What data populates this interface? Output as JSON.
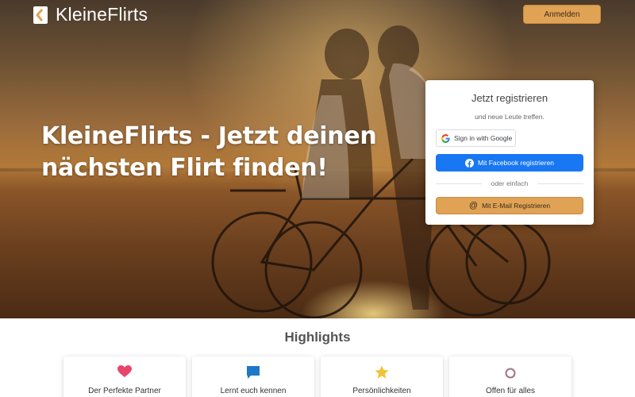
{
  "brand": {
    "name": "KleineFlirts",
    "colors": {
      "accent": "#e0a356",
      "facebook": "#1877f2",
      "heart": "#e8456b",
      "chat": "#1e78c8",
      "star": "#f1c232"
    }
  },
  "header": {
    "login_label": "Anmelden"
  },
  "hero": {
    "title": "KleineFlirts - Jetzt deinen nächsten Flirt finden!"
  },
  "registration": {
    "title": "Jetzt registrieren",
    "subtitle": "und neue Leute treffen.",
    "google_label": "Sign in with Google",
    "facebook_label": "Mit Facebook registrieren",
    "divider": "oder einfach",
    "email_label": "Mit E-Mail Registrieren"
  },
  "highlights": {
    "title": "Highlights",
    "items": [
      {
        "icon": "heart-icon",
        "label": "Der Perfekte Partner"
      },
      {
        "icon": "chat-icon",
        "label": "Lernt euch kennen"
      },
      {
        "icon": "star-icon",
        "label": "Persönlichkeiten"
      },
      {
        "icon": "circle-icon",
        "label": "Offen für alles"
      }
    ]
  }
}
